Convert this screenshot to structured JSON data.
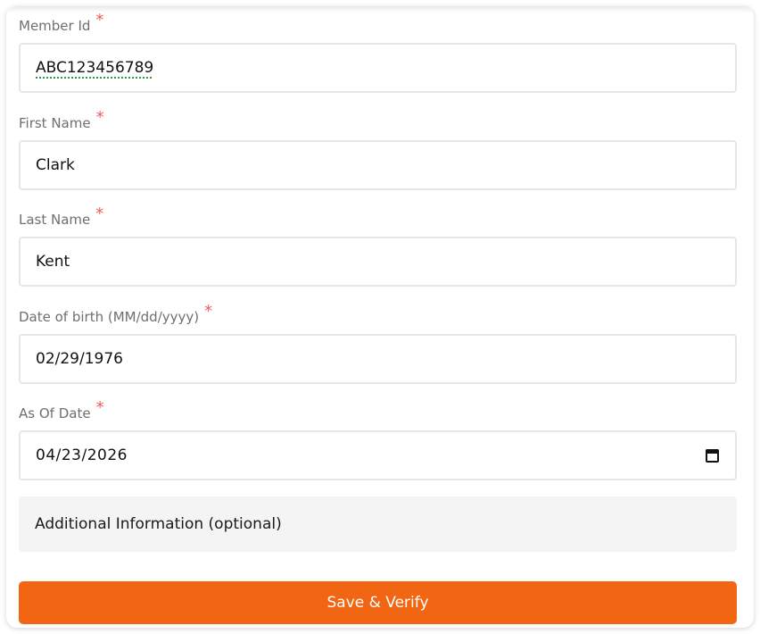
{
  "form": {
    "required_mark": "*",
    "fields": [
      {
        "label": "Member Id",
        "value": "ABC123456789"
      },
      {
        "label": "First Name",
        "value": "Clark"
      },
      {
        "label": "Last Name",
        "value": "Kent"
      },
      {
        "label": "Date of birth (MM/dd/yyyy)",
        "value": "02/29/1976"
      },
      {
        "label": "As Of Date",
        "value": "04/23/2026",
        "icon": "calendar-icon"
      }
    ],
    "additional_label": "Additional Information (optional)",
    "save_label": "Save & Verify"
  },
  "colors": {
    "accent": "#f26512",
    "required": "#ef5a5a",
    "label": "#6f6f6f",
    "input_border": "#e6e6e6",
    "section_bg": "#f4f4f4"
  }
}
